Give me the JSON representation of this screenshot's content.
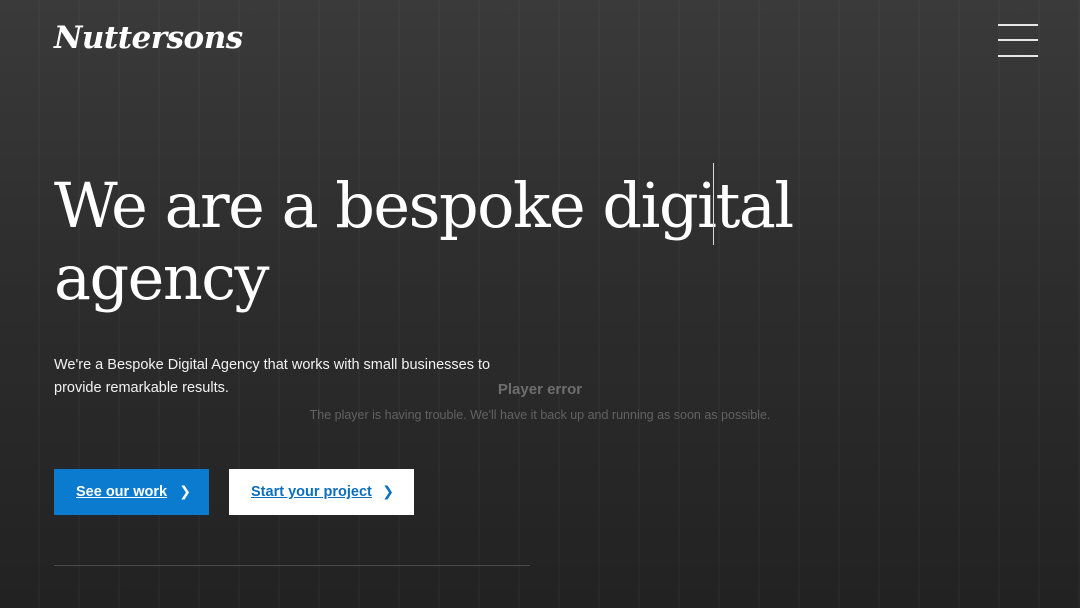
{
  "header": {
    "logo_text": "Nuttersons",
    "menu_icon": "hamburger-menu-icon"
  },
  "hero": {
    "title": "We are a bespoke digital agency",
    "description": "We're a Bespoke Digital Agency that works with small businesses to provide remarkable results."
  },
  "player_error": {
    "title": "Player error",
    "message": "The player is having trouble. We'll have it back up and running as soon as possible."
  },
  "buttons": {
    "primary_label": "See our work",
    "secondary_label": "Start your project",
    "chevron_icon": "chevron-right-icon"
  },
  "colors": {
    "accent": "#0b7bd0",
    "background": "#2d2d2d",
    "text": "#ffffff"
  }
}
